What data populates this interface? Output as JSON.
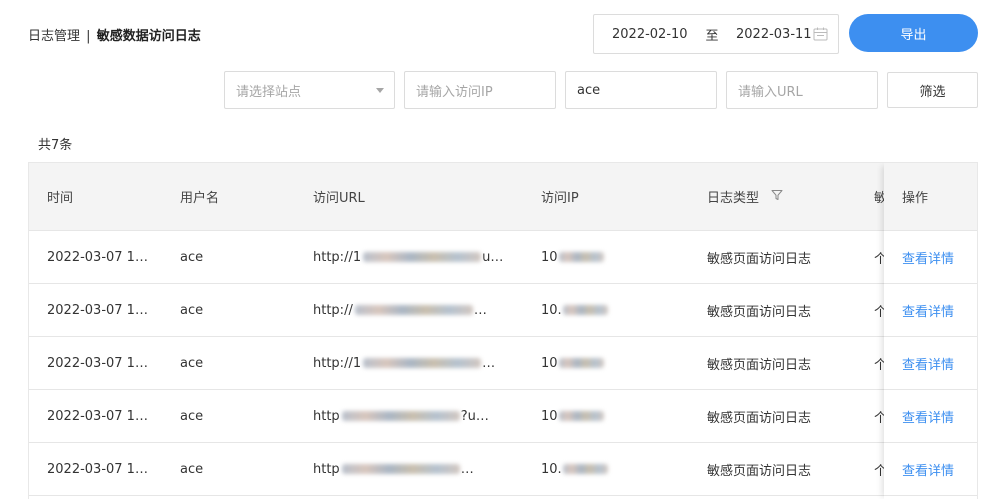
{
  "breadcrumb": {
    "parent": "日志管理",
    "separator": "|",
    "current": "敏感数据访问日志"
  },
  "date_range": {
    "start": "2022-02-10",
    "to_label": "至",
    "end": "2022-03-11"
  },
  "export_label": "导出",
  "filters": {
    "site_placeholder": "请选择站点",
    "ip_placeholder": "请输入访问IP",
    "user_value": "ace",
    "url_placeholder": "请输入URL",
    "button_label": "筛选"
  },
  "total_label": "共7条",
  "table": {
    "headers": {
      "time": "时间",
      "user": "用户名",
      "url": "访问URL",
      "ip": "访问IP",
      "type": "日志类型",
      "extra": "敏",
      "op": "操作"
    },
    "rows": [
      {
        "time": "2022-03-07 1…",
        "user": "ace",
        "url_prefix": "http://1",
        "url_suffix": "u…",
        "ip_prefix": "10",
        "type": "敏感页面访问日志",
        "extra": "个",
        "action": "查看详情"
      },
      {
        "time": "2022-03-07 1…",
        "user": "ace",
        "url_prefix": "http://",
        "url_suffix": "…",
        "ip_prefix": "10.",
        "type": "敏感页面访问日志",
        "extra": "个",
        "action": "查看详情"
      },
      {
        "time": "2022-03-07 1…",
        "user": "ace",
        "url_prefix": "http://1",
        "url_suffix": "…",
        "ip_prefix": "10",
        "type": "敏感页面访问日志",
        "extra": "个",
        "action": "查看详情"
      },
      {
        "time": "2022-03-07 1…",
        "user": "ace",
        "url_prefix": "http",
        "url_suffix": "?u…",
        "ip_prefix": "10",
        "type": "敏感页面访问日志",
        "extra": "个",
        "action": "查看详情"
      },
      {
        "time": "2022-03-07 1…",
        "user": "ace",
        "url_prefix": "http",
        "url_suffix": "…",
        "ip_prefix": "10.",
        "type": "敏感页面访问日志",
        "extra": "个",
        "action": "查看详情"
      }
    ]
  },
  "colors": {
    "accent": "#3d8ff0",
    "header_bg": "#f4f4f4",
    "border": "#e6e6e6"
  },
  "icons": {
    "date": "calendar-icon",
    "select": "caret-down-icon",
    "filter": "funnel-icon"
  }
}
